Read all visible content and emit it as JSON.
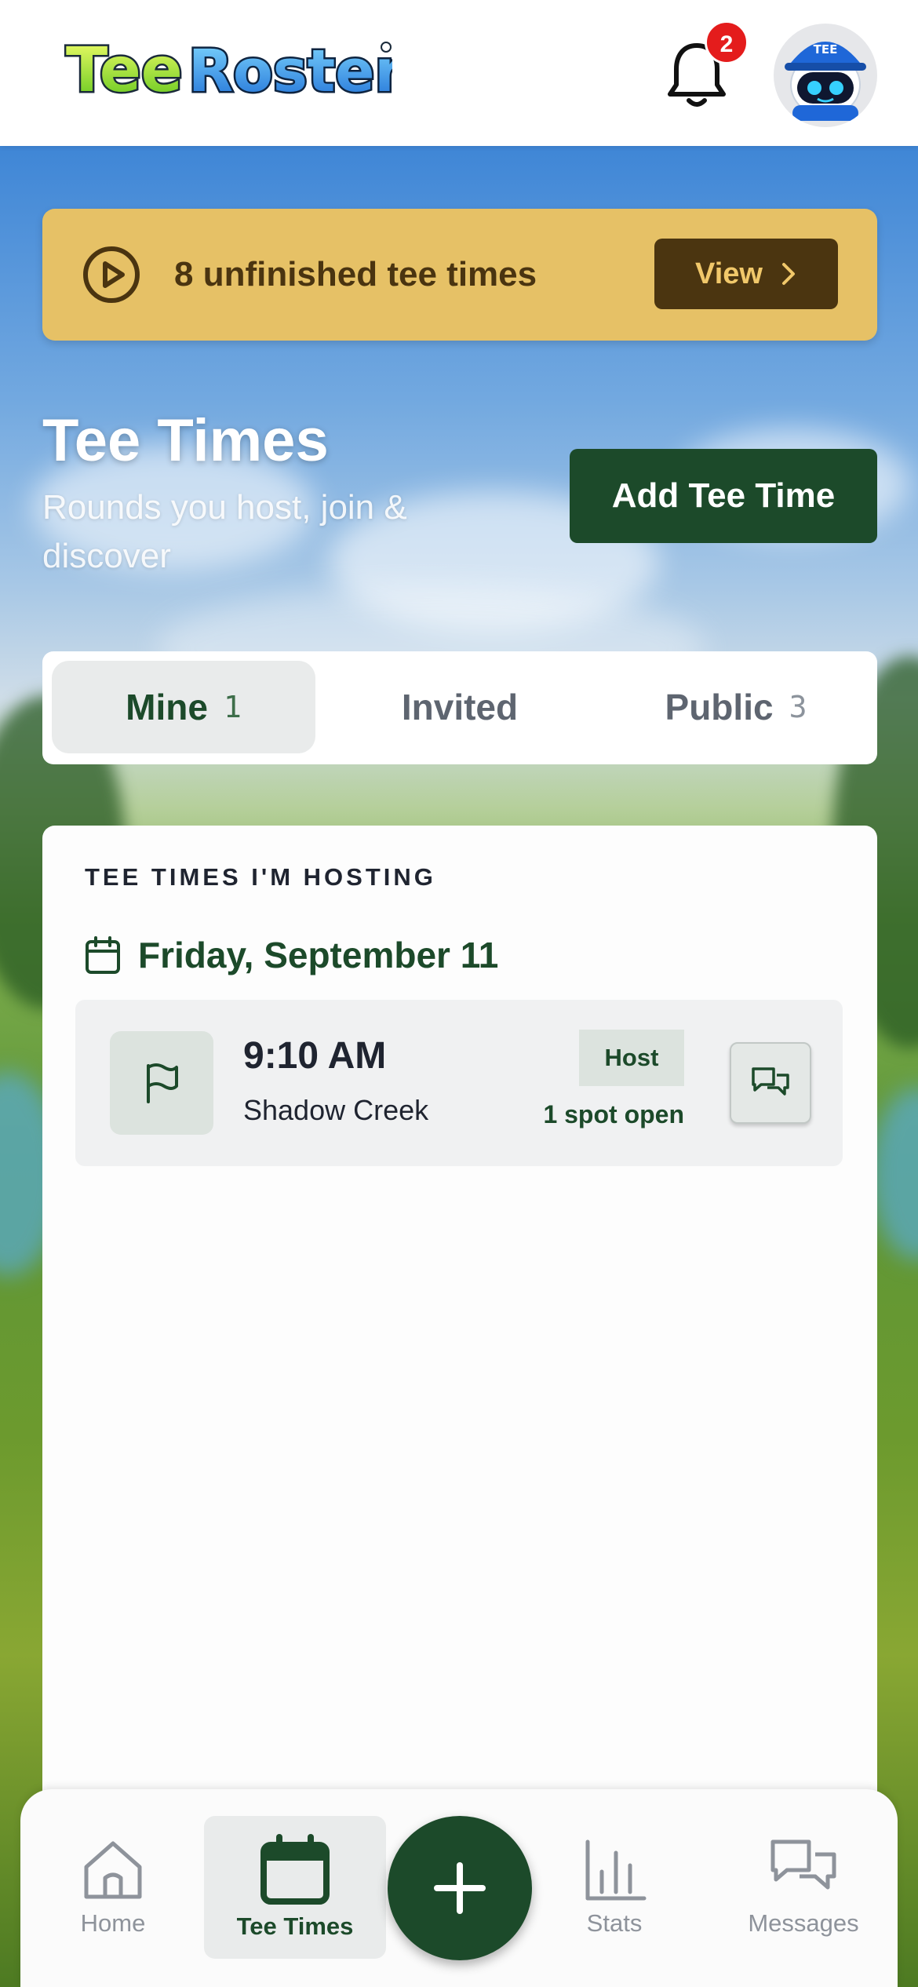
{
  "app": {
    "logo_text": "TeeRoster",
    "notification_count": "2",
    "avatar_cap_text": "TEE"
  },
  "banner": {
    "message": "8 unfinished tee times",
    "button_label": "View"
  },
  "page": {
    "title": "Tee Times",
    "subtitle": "Rounds you host, join & discover",
    "add_button_label": "Add Tee Time"
  },
  "tabs": [
    {
      "label": "Mine",
      "count": "1",
      "active": true
    },
    {
      "label": "Invited",
      "count": "",
      "active": false
    },
    {
      "label": "Public",
      "count": "3",
      "active": false
    }
  ],
  "hosting": {
    "section_label": "TEE TIMES I'M HOSTING",
    "date": "Friday, September 11",
    "tee_times": [
      {
        "time": "9:10 AM",
        "course": "Shadow Creek",
        "role": "Host",
        "spots": "1 spot open"
      }
    ]
  },
  "nav": {
    "items": [
      {
        "label": "Home",
        "icon": "home-icon"
      },
      {
        "label": "Tee Times",
        "icon": "calendar-icon",
        "active": true
      },
      {
        "label": "Stats",
        "icon": "bar-chart-icon"
      },
      {
        "label": "Messages",
        "icon": "chat-icon"
      }
    ],
    "fab_icon": "plus-icon"
  },
  "colors": {
    "brand_green": "#1c4a2a",
    "banner_gold": "#e6c166",
    "banner_brown": "#4b3510",
    "badge_red": "#e41c1c"
  }
}
